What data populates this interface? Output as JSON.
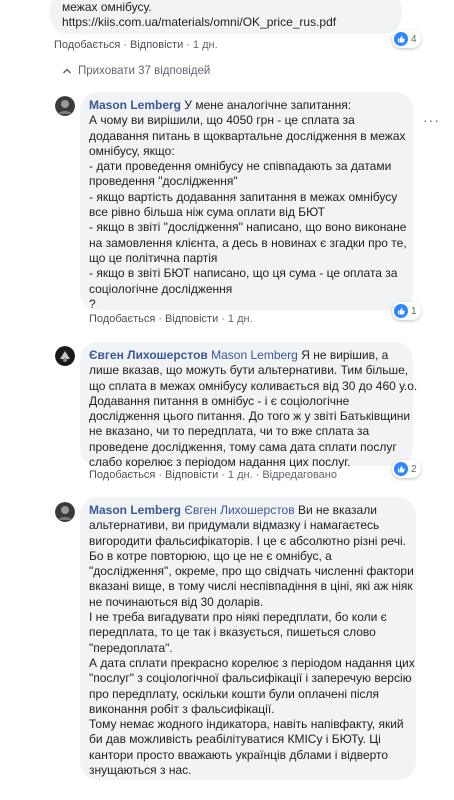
{
  "top_comment": {
    "text_lines": [
      "межах омнібусу.",
      "https://kiis.com.ua/materials/omni/OK_price_rus.pdf"
    ],
    "actions": {
      "like": "Подобається",
      "reply": "Відповісти",
      "time": "1 дн."
    },
    "reactions": "4"
  },
  "hide_replies": "Приховати 37 відповідей",
  "comments": [
    {
      "author": "Mason Lemberg",
      "mention": "",
      "first_line": "У мене аналогічне запитання:",
      "lines": [
        "А чому ви вирішили, що 4050 грн - це сплата за",
        "додавання питань в щоквартальне дослідження в межах",
        "омнібусу, якщо:",
        "- дати проведення омнібусу не співпадають за датами",
        "проведення \"дослідження\"",
        "- якщо вартість додавання запитання в межах омнібусу",
        "все рівно більша ніж сума оплати від БЮТ",
        "- якщо в звіті \"дослідження\" написано, що воно виконане",
        "на замовлення клієнта, а десь в новинах є згадки про те,",
        "що це політична партія",
        "- якщо в звіті БЮТ написано, що ця сума - це оплата за",
        "соціологічне дослідження",
        "?"
      ],
      "actions": {
        "like": "Подобається",
        "reply": "Відповісти",
        "time": "1 дн.",
        "edited": ""
      },
      "reactions": "1"
    },
    {
      "author": "Євген Лихошерстов",
      "mention": "Mason Lemberg",
      "first_line": "Я не вирішив, а",
      "lines": [
        "лише вказав, що можуть бути альтернативи. Тим більше,",
        "що сплата в межах омнібусу коливається від 30 до 460 у.о.",
        "Додавання питання в омнібус - і є соціологічне",
        "дослідження цього питання. До того ж у звіті Батьківщини",
        "не вказано, чи то передплата, чи то вже сплата за",
        "проведене дослідження, тому сама дата сплати послуг",
        "слабо корелює з періодом надання цих послуг."
      ],
      "actions": {
        "like": "Подобається",
        "reply": "Відповісти",
        "time": "1 дн.",
        "edited": "Відредаговано"
      },
      "reactions": "2"
    },
    {
      "author": "Mason Lemberg",
      "mention": "Євген Лихошерстов",
      "first_line": "Ви не вказали",
      "lines": [
        "альтернативи, ви придумали відмазку і намагаєтесь",
        "вигородити фальсифікаторів. І це є абсолютно різні речі.",
        "Бо в котре повторюю, що це не є омнібус, а",
        "\"дослідження\", окреме, про що свідчать численні фактори",
        "вказані вище, в тому числі неспівпадіння в ціні, які аж ніяк",
        "не починаються від 30 доларів.",
        "І не треба вигадувати про ніякі передплати, бо коли є",
        "передплата, то це так і вказується, пишеться слово",
        "\"передоплата\".",
        "А дата сплати прекрасно корелює з періодом надання цих",
        "\"послуг\" з соціологічної фальсифікації і заперечую версію",
        "про передплату, оскільки кошти були оплачені після",
        "виконання робіт з фальсифікації.",
        "Тому немає жодного індикатора, навіть напівфакту, який",
        "би дав можливість реабілітуватися КМІСу і БЮТу. Ці",
        "кантори просто вважають українців дблами і відверто",
        "знущаються з нас."
      ],
      "actions": {
        "like": "",
        "reply": "",
        "time": "",
        "edited": ""
      },
      "reactions": ""
    }
  ],
  "icons": {
    "like": "like-icon",
    "chevron": "chevron-up-icon",
    "more": "more-options-icon"
  },
  "colors": {
    "accent": "#385898",
    "like_blue": "#2d88ff",
    "bubble": "#f2f3f5"
  }
}
